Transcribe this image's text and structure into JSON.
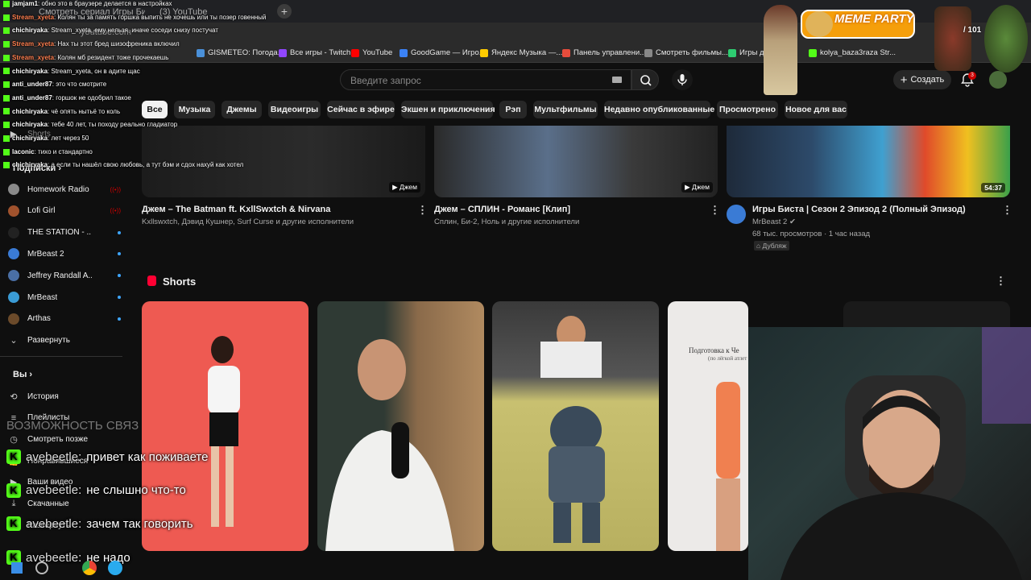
{
  "browser": {
    "tabs": [
      "Смотреть сериал Игры Биста",
      "(3) YouTube"
    ],
    "url": "youtube.com",
    "new_tab": "+",
    "bookmarks": [
      {
        "label": "GISMETEO: Погода...",
        "color": "#4a90d9"
      },
      {
        "label": "Все игры - Twitch",
        "color": "#9146ff"
      },
      {
        "label": "YouTube",
        "color": "#ff0000"
      },
      {
        "label": "GoodGame — Игро...",
        "color": "#3b82f6"
      },
      {
        "label": "Яндекс Музыка —...",
        "color": "#ffcc00"
      },
      {
        "label": "Панель управлени...",
        "color": "#e74c3c"
      },
      {
        "label": "Смотреть фильмы...",
        "color": "#888888"
      },
      {
        "label": "Игры для...",
        "color": "#2ecc71"
      },
      {
        "label": "kolya_baza3raza Str...",
        "color": "#53fc18"
      }
    ]
  },
  "header": {
    "search_placeholder": "Введите запрос",
    "create_label": "Создать",
    "notifications_count": "3"
  },
  "chips": [
    "Все",
    "Музыка",
    "Джемы",
    "Видеоигры",
    "Сейчас в эфире",
    "Экшен и приключения",
    "Рэп",
    "Мультфильмы",
    "Недавно опубликованные",
    "Просмотрено",
    "Новое для вас"
  ],
  "sidebar": {
    "shorts_label": "Shorts",
    "subscriptions_header": "Подписки",
    "subscriptions": [
      {
        "label": "Homework Radio",
        "status": "live",
        "color": "#8a8a8a"
      },
      {
        "label": "Lofi Girl",
        "status": "live",
        "color": "#a0522d"
      },
      {
        "label": "THE STATION - ...",
        "status": "new",
        "color": "#222222"
      },
      {
        "label": "MrBeast 2",
        "status": "new",
        "color": "#3a7bd5"
      },
      {
        "label": "Jeffrey Randall A...",
        "status": "new",
        "color": "#4a6fa5"
      },
      {
        "label": "MrBeast",
        "status": "new",
        "color": "#3a9bd5"
      },
      {
        "label": "Arthas",
        "status": "new",
        "color": "#6b4a2a"
      }
    ],
    "expand_label": "Развернуть",
    "you_header": "Вы",
    "you_items": [
      "История",
      "Плейлисты",
      "Смотреть позже",
      "Понравившиеся",
      "Ваши видео",
      "Скачанные",
      "Развернуть"
    ]
  },
  "videos": [
    {
      "title": "Джем – The Batman ft. KxllSwxtch & Nirvana",
      "meta": "Kxllswxtch, Дэвид Кушнер, Surf Curse и другие исполнители",
      "badge": "Джем"
    },
    {
      "title": "Джем – СПЛИН - Романс [Клип]",
      "meta": "Сплин, Би-2, Ноль и другие исполнители",
      "badge": "Джем"
    },
    {
      "title": "Игры Биста | Сезон 2 Эпизод 2 (Полный Эпизод)",
      "channel": "MrBeast 2",
      "meta": "68 тыс. просмотров · 1 час назад",
      "tag": "Дубляж",
      "duration": "54:37"
    }
  ],
  "shorts_section": {
    "title": "Shorts"
  },
  "shorts_texts": {
    "card4_caption": "Подготовка к Че",
    "card4_sub": "(по лёгкой атлет"
  },
  "chat": [
    {
      "user": "jamjam1",
      "color": "#ffffff",
      "text": "обно это в браузере делается в настройках"
    },
    {
      "user": "Stream_xyeta",
      "color": "#ff7f50",
      "text": "Колян ты за память горшка выпить не хочешь или ты позер говенный"
    },
    {
      "user": "chichiryaka",
      "color": "#ffffff",
      "text": "Stream_xyeta, ему нельзя, иначе соседи снизу постучат"
    },
    {
      "user": "Stream_xyeta",
      "color": "#ff7f50",
      "text": "Нах ты этот бред шизофреника включил"
    },
    {
      "user": "Stream_xyeta",
      "color": "#ff7f50",
      "text": "Колян мб резидент тоже прочекаешь"
    },
    {
      "user": "chichiryaka",
      "color": "#ffffff",
      "text": "Stream_xyeta, он в адите щас"
    },
    {
      "user": "anti_under87",
      "color": "#ffffff",
      "text": "это что смотрите"
    },
    {
      "user": "anti_under87",
      "color": "#ffffff",
      "text": "горшок не одобрил такое"
    },
    {
      "user": "chichiryaka",
      "color": "#ffffff",
      "text": "чё опять нытьё то коль"
    },
    {
      "user": "chichiryaka",
      "color": "#ffffff",
      "text": "тебе 40 лет, ты походу реально гладиатор"
    },
    {
      "user": "chichiryaka",
      "color": "#ffffff",
      "text": "лет через 50"
    },
    {
      "user": "laconic",
      "color": "#ffffff",
      "text": "тихо и стандартно"
    },
    {
      "user": "chichiryaka",
      "color": "#ffffff",
      "text": "а если ты нашёл свою любовь, а тут бэм и сдох нахуй как хотел"
    }
  ],
  "big_chat": [
    {
      "user": "avebeetle",
      "text": "привет как поживаете"
    },
    {
      "user": "avebeetle",
      "text": "не слышно что-то"
    },
    {
      "user": "avebeetle",
      "text": "зачем так говорить"
    },
    {
      "user": "avebeetle",
      "text": "не надо"
    }
  ],
  "overlay": {
    "meme_party": "MEME PARTY",
    "counter": "/ 101",
    "ghost_text": "ВОЗМОЖНОСТЬ СВЯЗ"
  },
  "colors": {
    "accent_red": "#cc0000",
    "kick_green": "#53fc18",
    "link_blue": "#3ea6ff"
  }
}
